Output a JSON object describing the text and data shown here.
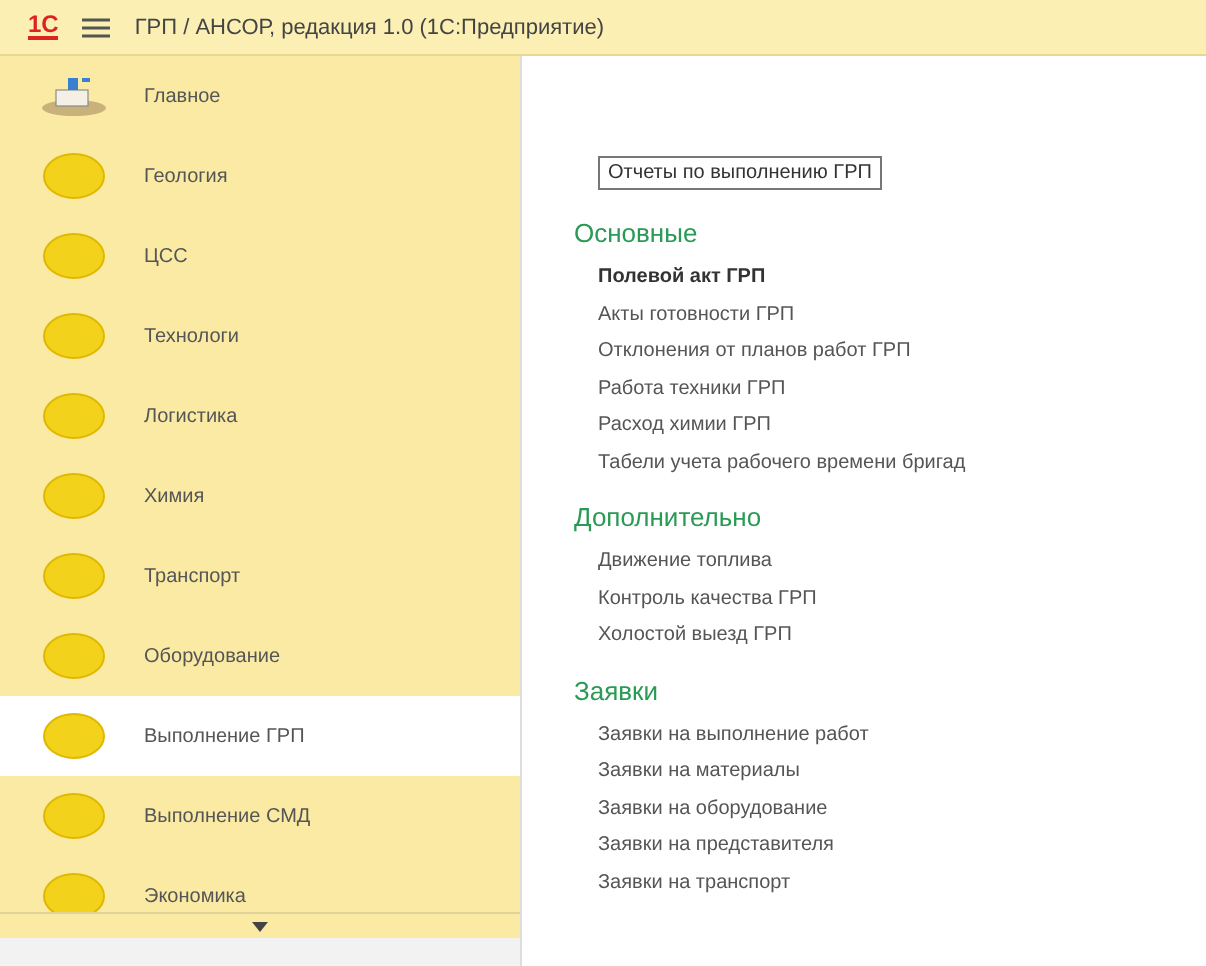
{
  "window": {
    "logo": "1С",
    "title": "ГРП / АНСОР, редакция 1.0  (1С:Предприятие)"
  },
  "sidebar": {
    "items": [
      {
        "label": "Главное",
        "kind": "home",
        "selected": false
      },
      {
        "label": "Геология",
        "kind": "section",
        "selected": false
      },
      {
        "label": "ЦСС",
        "kind": "section",
        "selected": false
      },
      {
        "label": "Технологи",
        "kind": "section",
        "selected": false
      },
      {
        "label": "Логистика",
        "kind": "section",
        "selected": false
      },
      {
        "label": "Химия",
        "kind": "section",
        "selected": false
      },
      {
        "label": "Транспорт",
        "kind": "section",
        "selected": false
      },
      {
        "label": "Оборудование",
        "kind": "section",
        "selected": false
      },
      {
        "label": "Выполнение ГРП",
        "kind": "section",
        "selected": true
      },
      {
        "label": "Выполнение СМД",
        "kind": "section",
        "selected": false
      },
      {
        "label": "Экономика",
        "kind": "section",
        "selected": false
      }
    ]
  },
  "content": {
    "report_button": "Отчеты по выполнению ГРП",
    "groups": [
      {
        "title": "Основные",
        "items": [
          {
            "label": "Полевой акт ГРП",
            "bold": true
          },
          {
            "label": "Акты готовности ГРП",
            "bold": false
          },
          {
            "label": "Отклонения от планов работ ГРП",
            "bold": false
          },
          {
            "label": "Работа техники ГРП",
            "bold": false
          },
          {
            "label": "Расход химии ГРП",
            "bold": false
          },
          {
            "label": "Табели учета рабочего времени бригад",
            "bold": false
          }
        ]
      },
      {
        "title": "Дополнительно",
        "items": [
          {
            "label": "Движение топлива",
            "bold": false
          },
          {
            "label": "Контроль качества ГРП",
            "bold": false
          },
          {
            "label": "Холостой выезд ГРП",
            "bold": false
          }
        ]
      },
      {
        "title": "Заявки",
        "items": [
          {
            "label": "Заявки на выполнение работ",
            "bold": false
          },
          {
            "label": "Заявки на материалы",
            "bold": false
          },
          {
            "label": "Заявки на оборудование",
            "bold": false
          },
          {
            "label": "Заявки на представителя",
            "bold": false
          },
          {
            "label": "Заявки на транспорт",
            "bold": false
          }
        ]
      }
    ]
  }
}
